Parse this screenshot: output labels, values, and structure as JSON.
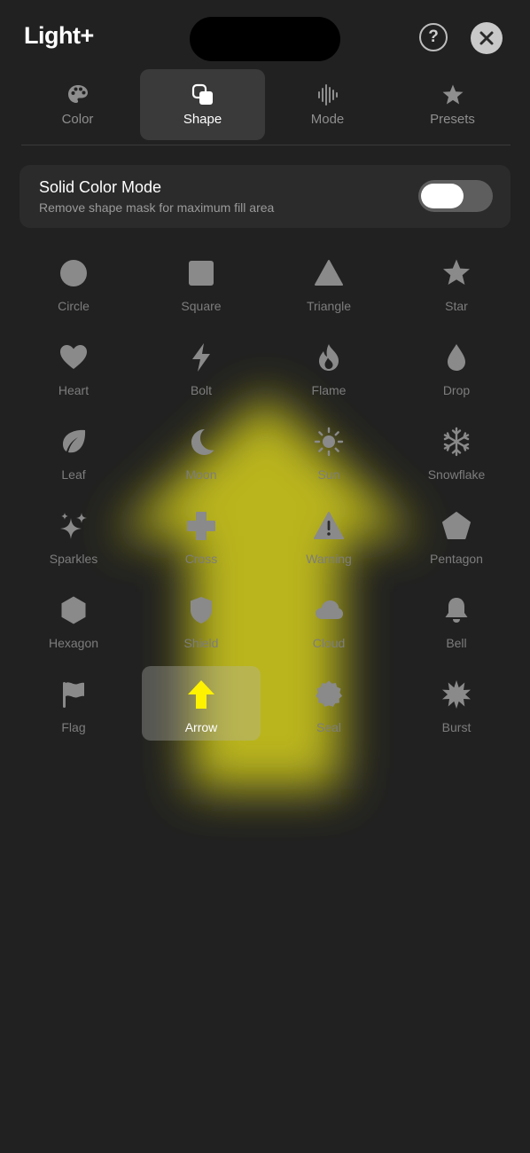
{
  "app": {
    "title": "Light+"
  },
  "header": {
    "help_label": "?"
  },
  "tabs": [
    {
      "label": "Color",
      "icon": "palette-icon",
      "active": false
    },
    {
      "label": "Shape",
      "icon": "shapes-icon",
      "active": true
    },
    {
      "label": "Mode",
      "icon": "waveform-icon",
      "active": false
    },
    {
      "label": "Presets",
      "icon": "star-icon",
      "active": false
    }
  ],
  "solid_color_mode": {
    "title": "Solid Color Mode",
    "subtitle": "Remove shape mask for maximum fill area",
    "enabled": true
  },
  "shapes": [
    {
      "label": "Circle",
      "icon": "circle-icon"
    },
    {
      "label": "Square",
      "icon": "square-icon"
    },
    {
      "label": "Triangle",
      "icon": "triangle-icon"
    },
    {
      "label": "Star",
      "icon": "star-icon"
    },
    {
      "label": "Heart",
      "icon": "heart-icon"
    },
    {
      "label": "Bolt",
      "icon": "bolt-icon"
    },
    {
      "label": "Flame",
      "icon": "flame-icon"
    },
    {
      "label": "Drop",
      "icon": "drop-icon"
    },
    {
      "label": "Leaf",
      "icon": "leaf-icon"
    },
    {
      "label": "Moon",
      "icon": "moon-icon"
    },
    {
      "label": "Sun",
      "icon": "sun-icon"
    },
    {
      "label": "Snowflake",
      "icon": "snowflake-icon"
    },
    {
      "label": "Sparkles",
      "icon": "sparkles-icon"
    },
    {
      "label": "Cross",
      "icon": "cross-icon"
    },
    {
      "label": "Warning",
      "icon": "warning-icon"
    },
    {
      "label": "Pentagon",
      "icon": "pentagon-icon"
    },
    {
      "label": "Hexagon",
      "icon": "hexagon-icon"
    },
    {
      "label": "Shield",
      "icon": "shield-icon"
    },
    {
      "label": "Cloud",
      "icon": "cloud-icon"
    },
    {
      "label": "Bell",
      "icon": "bell-icon"
    },
    {
      "label": "Flag",
      "icon": "flag-icon"
    },
    {
      "label": "Arrow",
      "icon": "arrow-up-icon"
    },
    {
      "label": "Seal",
      "icon": "seal-icon"
    },
    {
      "label": "Burst",
      "icon": "burst-icon"
    }
  ],
  "selected_shape": "Arrow",
  "colors": {
    "background": "#212121",
    "accent": "#FFF200",
    "glow": "#C8C21E",
    "icon": "#8A8A8A"
  }
}
